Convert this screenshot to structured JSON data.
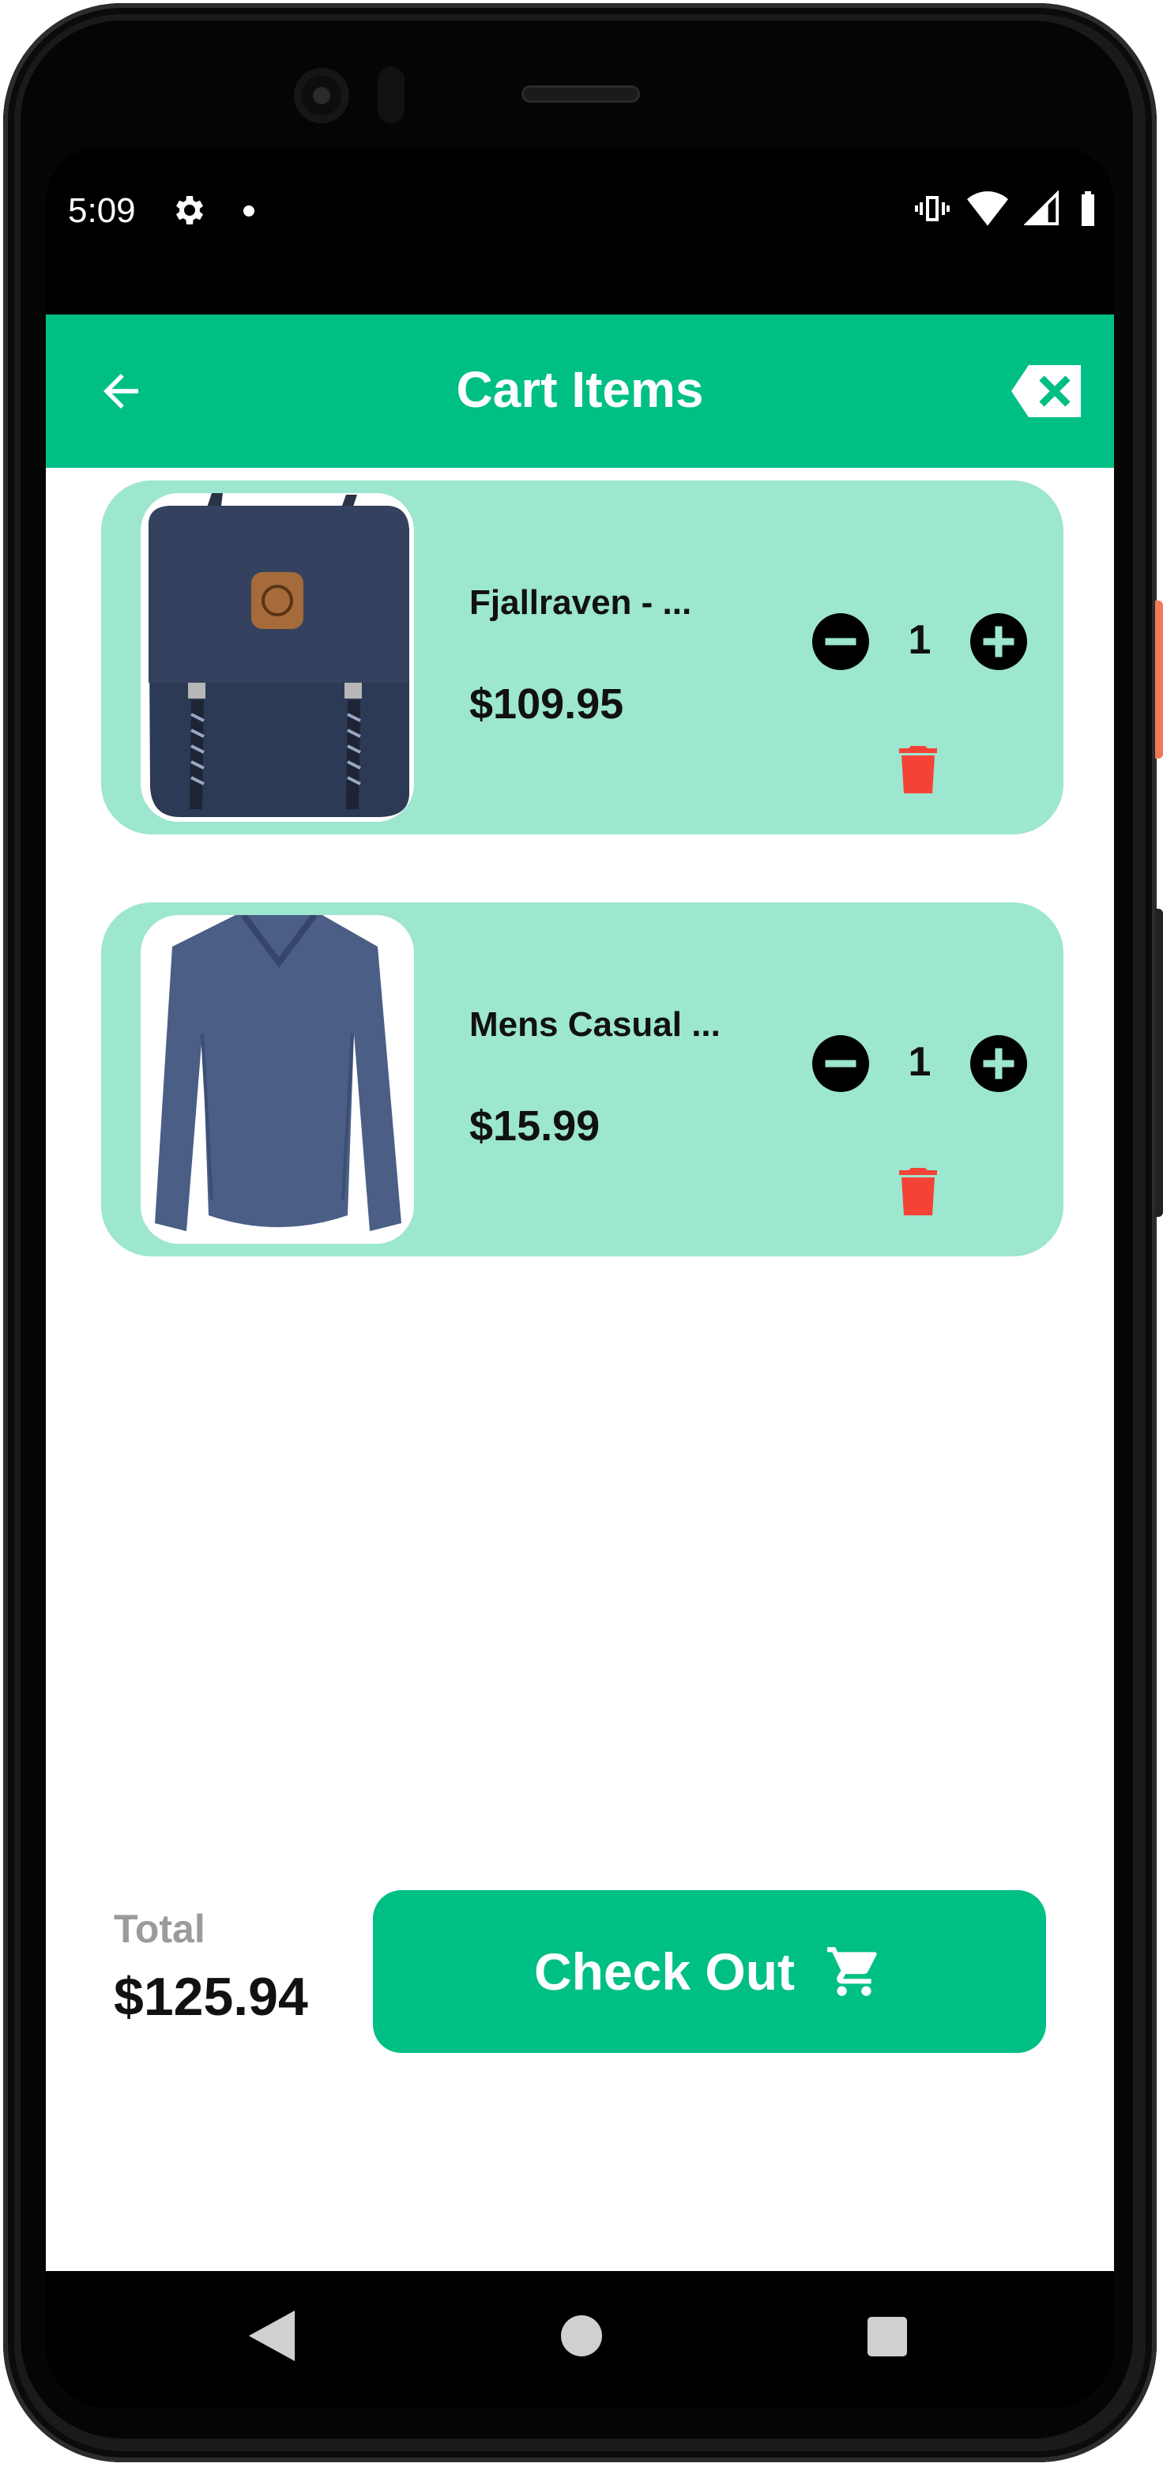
{
  "status_bar": {
    "time": "5:09",
    "left_icons": [
      "gear-icon",
      "notification-dot-icon"
    ],
    "right_icons": [
      "vibrate-icon",
      "wifi-icon",
      "signal-icon",
      "battery-icon"
    ]
  },
  "app_bar": {
    "title": "Cart Items",
    "back_icon": "arrow-back-icon",
    "clear_icon": "backspace-clear-icon",
    "background_color": "#00bf85"
  },
  "cart": {
    "card_color": "#9de6cf",
    "items": [
      {
        "title": "Fjallraven - ...",
        "price": "$109.95",
        "quantity": "1",
        "image": "backpack"
      },
      {
        "title": "Mens Casual ...",
        "price": "$15.99",
        "quantity": "1",
        "image": "long-sleeve-shirt"
      }
    ],
    "delete_color": "#f44336"
  },
  "footer": {
    "total_label": "Total",
    "total_value": "$125.94",
    "checkout_label": "Check Out",
    "checkout_icon": "cart-icon",
    "accent_color": "#00bf85"
  },
  "nav_bar": {
    "icons": [
      "nav-back-icon",
      "nav-home-icon",
      "nav-recents-icon"
    ]
  }
}
